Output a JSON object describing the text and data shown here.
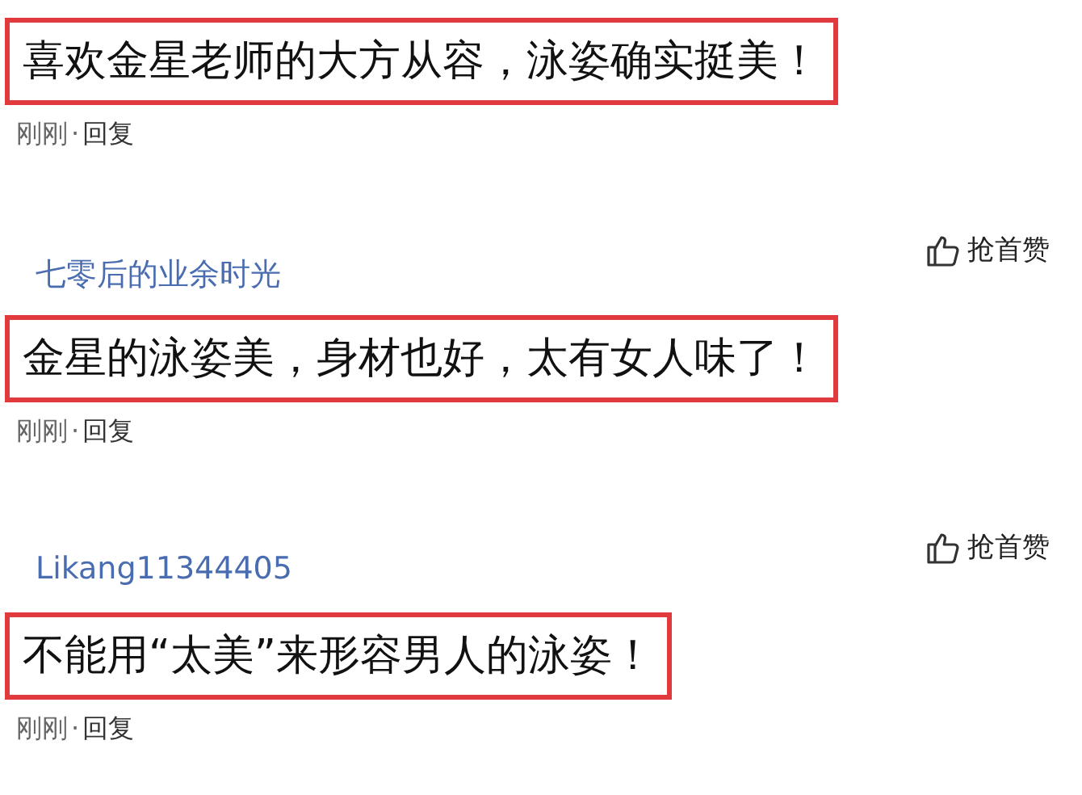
{
  "comments": [
    {
      "text": "喜欢金星老师的大方从容，泳姿确实挺美！",
      "highlighted": true,
      "time": "刚刚",
      "separator": "·",
      "reply": "回复"
    },
    {
      "user": "七零后的业余时光",
      "like": "抢首赞",
      "text": "金星的泳姿美，身材也好，太有女人味了！",
      "highlighted": true,
      "time": "刚刚",
      "separator": "·",
      "reply": "回复"
    },
    {
      "user": "Likang11344405",
      "like": "抢首赞",
      "text": "不能用“太美”来形容男人的泳姿！",
      "highlighted": true,
      "time": "刚刚",
      "separator": "·",
      "reply": "回复"
    }
  ]
}
